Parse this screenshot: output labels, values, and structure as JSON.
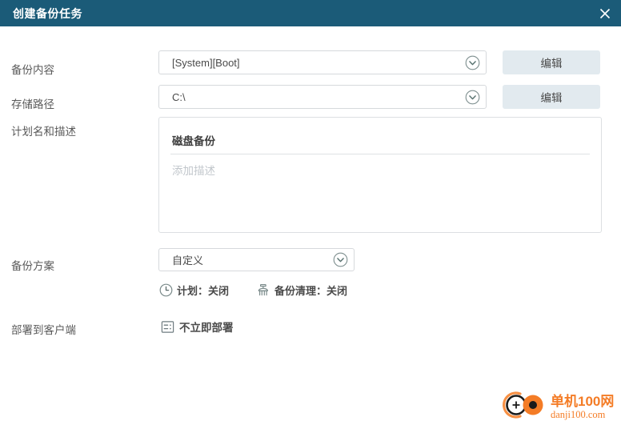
{
  "window": {
    "title": "创建备份任务",
    "close_icon": "close-icon",
    "accent_color": "#1b5b78",
    "title_color": "#ffffff"
  },
  "fields": {
    "backup_content": {
      "label": "备份内容",
      "value": "[System][Boot]",
      "caret_icon": "chevron-down-circle-icon",
      "edit_label": "编辑"
    },
    "storage_path": {
      "label": "存储路径",
      "value": "C:\\",
      "caret_icon": "chevron-down-circle-icon",
      "edit_label": "编辑"
    },
    "plan_name": {
      "label": "计划名和描述",
      "name_value": "磁盘备份",
      "description_placeholder": "添加描述"
    },
    "backup_scheme": {
      "label": "备份方案",
      "value": "自定义",
      "caret_icon": "chevron-down-circle-icon"
    },
    "deploy": {
      "label": "部署到客户端",
      "value": "不立即部署",
      "icon": "deploy-grid-icon"
    }
  },
  "status": {
    "schedule": {
      "icon": "clock-icon",
      "text": "计划：关闭"
    },
    "cleanup": {
      "icon": "broom-cleanup-icon",
      "text": "备份清理：关闭"
    }
  },
  "watermark": {
    "logo_icon": "danji-logo-icon",
    "cn": "单机100网",
    "en": "danji100.com",
    "color": "#f47c26"
  }
}
